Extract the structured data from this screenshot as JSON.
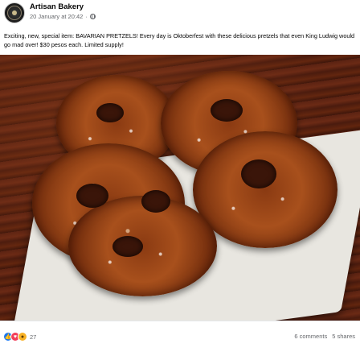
{
  "post": {
    "page_name": "Artisan Bakery",
    "timestamp": "20 January at 20:42",
    "privacy_icon": "globe-icon",
    "text": "Exciting, new, special item: BAVARIAN PRETZELS! Every day is Oktoberfest with these delicious pretzels that even King Ludwig would go mad over!  $30 pesos each. Limited supply!"
  },
  "footer": {
    "reaction_icons": [
      "like-icon",
      "love-icon",
      "wow-icon"
    ],
    "reaction_count": "27",
    "comments": "6 comments",
    "shares": "5 shares"
  },
  "colors": {
    "like": "#1877f2",
    "love": "#f33e58",
    "wow": "#f7b125",
    "secondary_text": "#65676b"
  }
}
